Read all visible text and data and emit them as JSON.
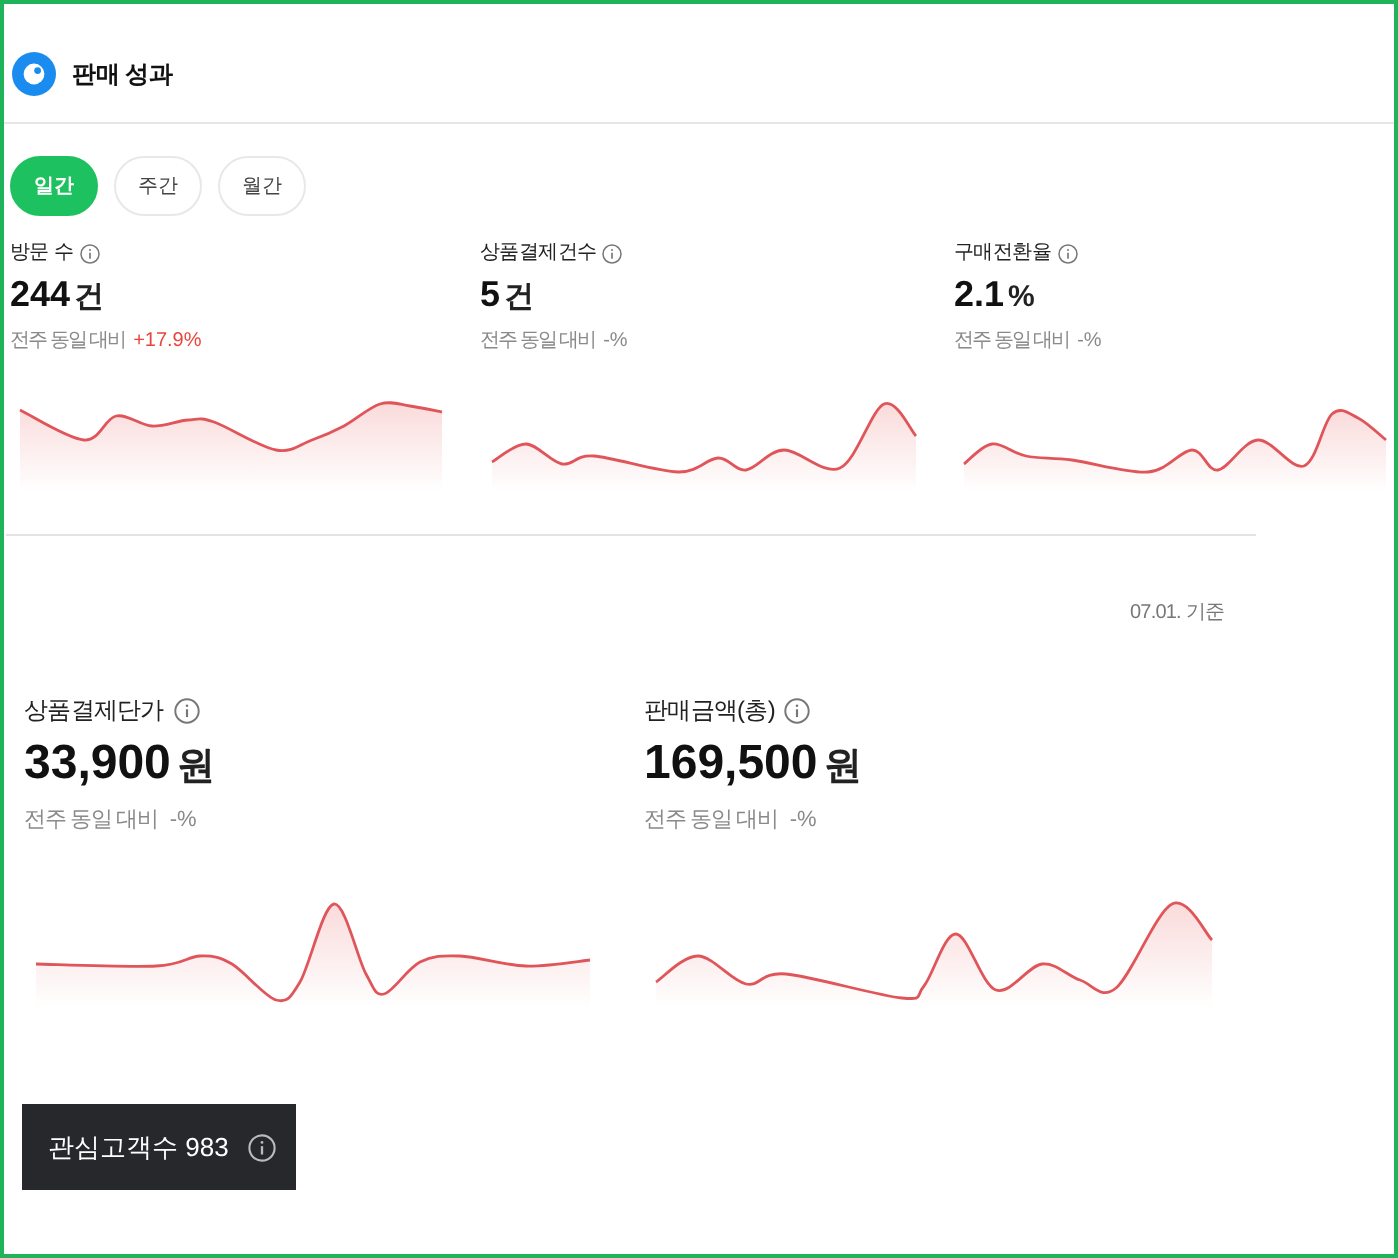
{
  "header": {
    "title": "판매 성과"
  },
  "tabs": [
    {
      "label": "일간",
      "selected": true
    },
    {
      "label": "주간",
      "selected": false
    },
    {
      "label": "월간",
      "selected": false
    }
  ],
  "metrics": [
    {
      "label": "방문 수",
      "value": "244",
      "unit": "건",
      "compare_label": "전주 동일 대비",
      "delta": "+17.9%",
      "increase": true
    },
    {
      "label": "상품결제건수",
      "value": "5",
      "unit": "건",
      "compare_label": "전주 동일 대비",
      "delta": "-%",
      "increase": false
    },
    {
      "label": "구매전환율",
      "value": "2.1",
      "unit": "%",
      "compare_label": "전주 동일 대비",
      "delta": "-%",
      "increase": false
    }
  ],
  "as_of": "07.01. 기준",
  "summary_metrics": [
    {
      "label": "상품결제단가",
      "value": "33,900",
      "unit": "원",
      "compare_label": "전주 동일 대비",
      "delta": "-%",
      "increase": false
    },
    {
      "label": "판매금액(총)",
      "value": "169,500",
      "unit": "원",
      "compare_label": "전주 동일 대비",
      "delta": "-%",
      "increase": false
    }
  ],
  "interest_panel": {
    "text": "관심고객수 983"
  }
}
